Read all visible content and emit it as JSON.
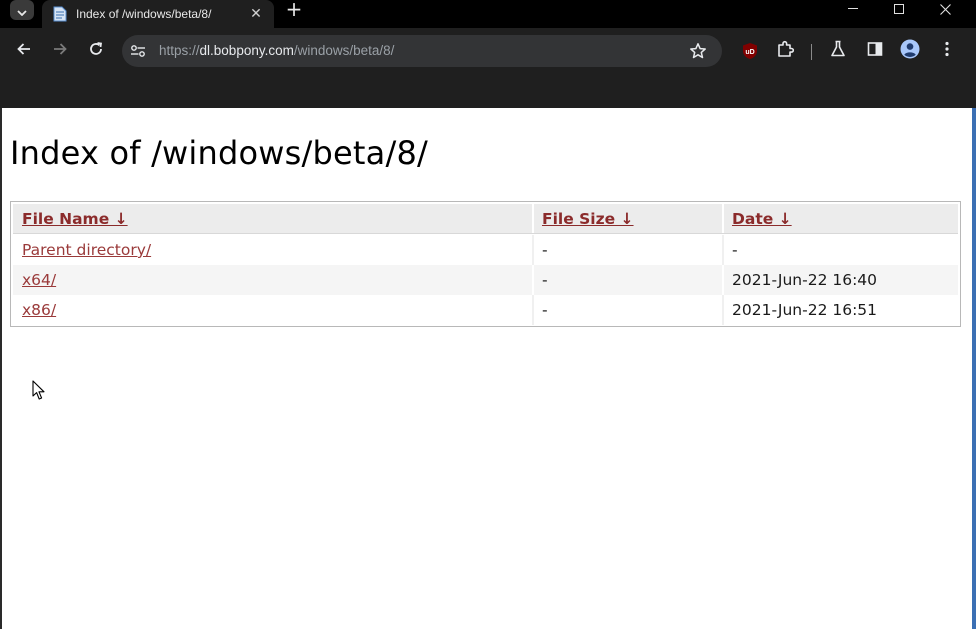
{
  "browser": {
    "tab": {
      "title": "Index of /windows/beta/8/",
      "close_glyph": "✕"
    },
    "new_tab_glyph": "+",
    "window_controls": {
      "minimize": "—",
      "maximize": "☐",
      "close": "✕"
    },
    "url": {
      "scheme": "https://",
      "host": "dl.bobpony.com",
      "path": "/windows/beta/8/"
    },
    "extension_badge": "uD",
    "icons": [
      "tab-search-icon",
      "page-favicon",
      "back-arrow-icon",
      "forward-arrow-icon",
      "reload-icon",
      "site-info-icon",
      "bookmark-star-icon",
      "ublock-extension-icon",
      "extensions-puzzle-icon",
      "labs-flask-icon",
      "side-panel-icon",
      "profile-avatar-icon",
      "more-menu-icon",
      "mouse-cursor-icon"
    ]
  },
  "page": {
    "heading": "Index of /windows/beta/8/",
    "table": {
      "headers": {
        "name": "File Name  ↓",
        "size": "File Size  ↓",
        "date": "Date  ↓"
      },
      "rows": [
        {
          "name": "Parent directory/",
          "size": "-",
          "date": "-"
        },
        {
          "name": "x64/",
          "size": "-",
          "date": "2021-Jun-22 16:40"
        },
        {
          "name": "x86/",
          "size": "-",
          "date": "2021-Jun-22 16:51"
        }
      ]
    },
    "colors": {
      "link": "#9a3a3a",
      "header_link": "#8b2b2b",
      "chrome_dark": "#1f1f1f",
      "omnibox": "#333436"
    }
  }
}
